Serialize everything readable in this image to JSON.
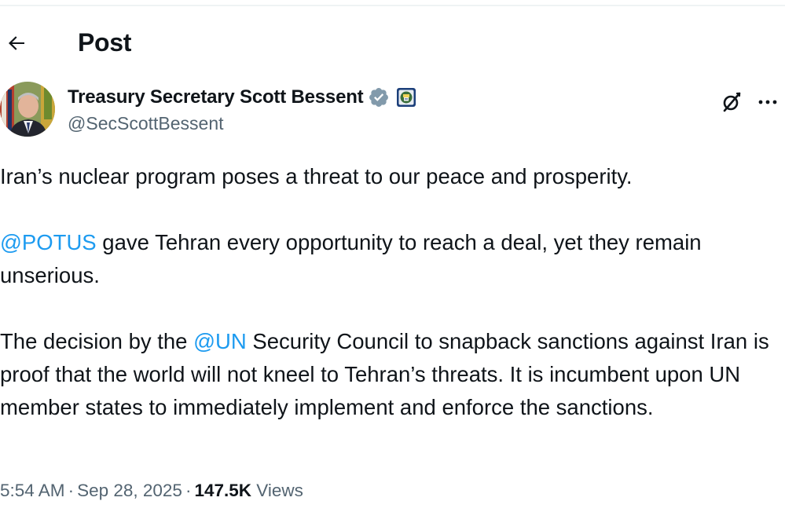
{
  "header": {
    "title": "Post"
  },
  "author": {
    "display_name": "Treasury Secretary Scott Bessent",
    "handle": "@SecScottBessent"
  },
  "tweet": {
    "p1": "Iran’s nuclear program poses a threat to our peace and prosperity.",
    "p2_mention": "@POTUS",
    "p2_rest": " gave Tehran every opportunity to reach a deal, yet they remain unserious.",
    "p3_pre": "The decision by the ",
    "p3_mention": "@UN",
    "p3_rest": " Security Council to snapback sanctions against Iran is proof that the world will not kneel to Tehran’s threats. It is incumbent upon UN member states to immediately implement and enforce the sanctions."
  },
  "meta": {
    "time": "5:54 AM",
    "separator": "·",
    "date": "Sep 28, 2025",
    "views_count": "147.5K",
    "views_label": "Views"
  },
  "icons": {
    "back": "arrow-left-icon",
    "verified": "verified-badge-icon",
    "affiliation": "treasury-seal-icon",
    "grok": "grok-icon",
    "more": "more-horizontal-icon"
  },
  "colors": {
    "link": "#1d9bf0",
    "secondary_text": "#536471",
    "primary_text": "#0f1419",
    "verified_badge": "#829aab"
  }
}
